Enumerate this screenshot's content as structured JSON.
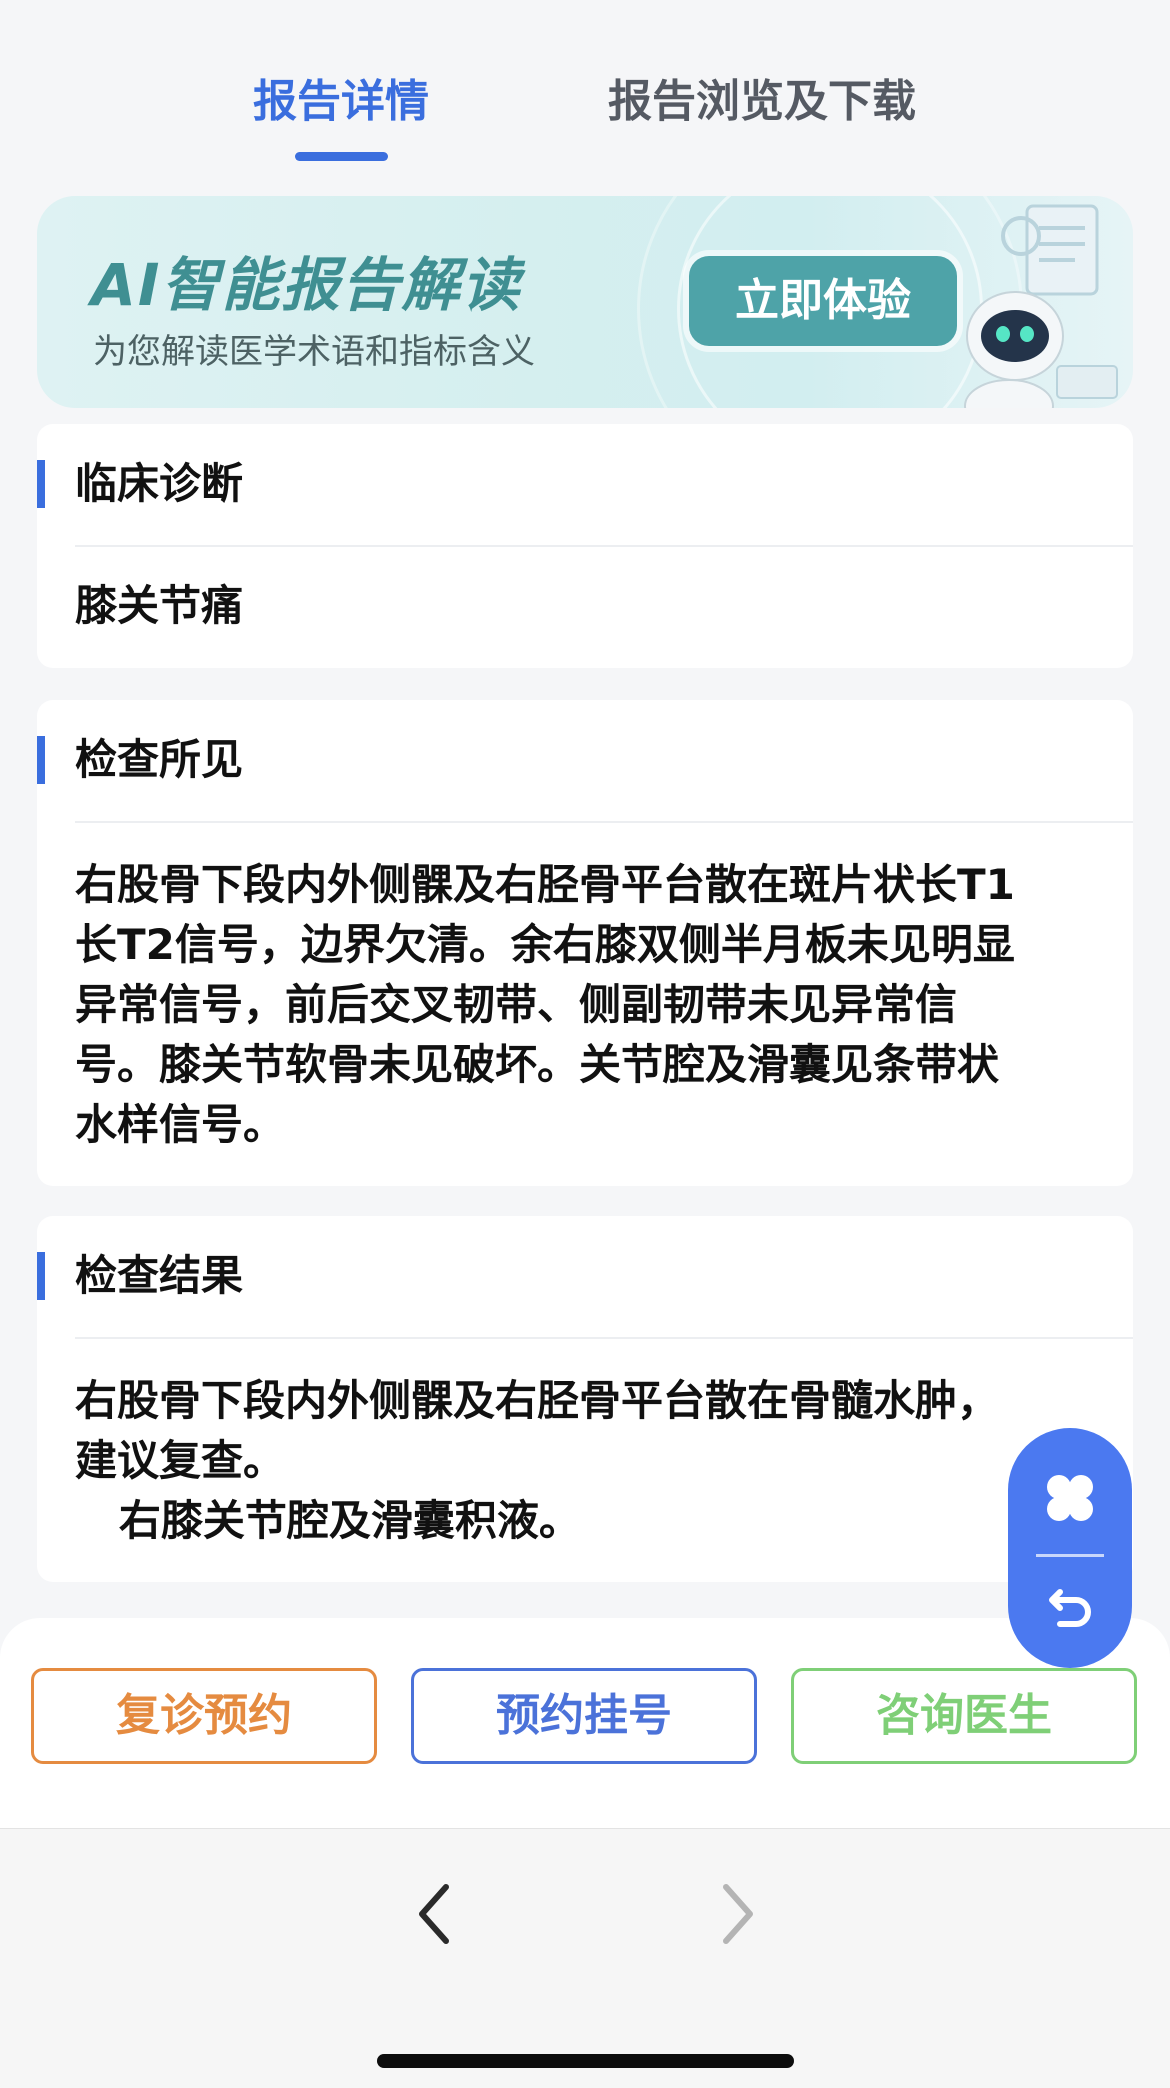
{
  "tabs": [
    {
      "label": "报告详情",
      "active": true
    },
    {
      "label": "报告浏览及下载",
      "active": false
    }
  ],
  "banner": {
    "title": "AI智能报告解读",
    "subtitle": "为您解读医学术语和指标含义",
    "button_label": "立即体验"
  },
  "sections": {
    "diagnosis": {
      "title": "临床诊断",
      "content": "膝关节痛"
    },
    "findings": {
      "title": "检查所见",
      "content": "右股骨下段内外侧髁及右胫骨平台散在斑片状长T1\n长T2信号，边界欠清。余右膝双侧半月板未见明显\n异常信号，前后交叉韧带、侧副韧带未见异常信\n号。膝关节软骨未见破坏。关节腔及滑囊见条带状\n水样信号。"
    },
    "results": {
      "title": "检查结果",
      "content": "右股骨下段内外侧髁及右胫骨平台散在骨髓水肿，\n建议复查。\n   右膝关节腔及滑囊积液。"
    }
  },
  "actions": {
    "followup_label": "复诊预约",
    "register_label": "预约挂号",
    "consult_label": "咨询医生"
  },
  "colors": {
    "accent": "#3a6ede",
    "followup": "#e58b40",
    "register": "#4b72d9",
    "consult": "#7fcf77",
    "banner_teal": "#4ea3a8"
  },
  "icons": {
    "float_top": "clover-menu-icon",
    "float_bottom": "return-arrow-icon",
    "nav_back": "chevron-left-icon",
    "nav_forward": "chevron-right-icon"
  }
}
